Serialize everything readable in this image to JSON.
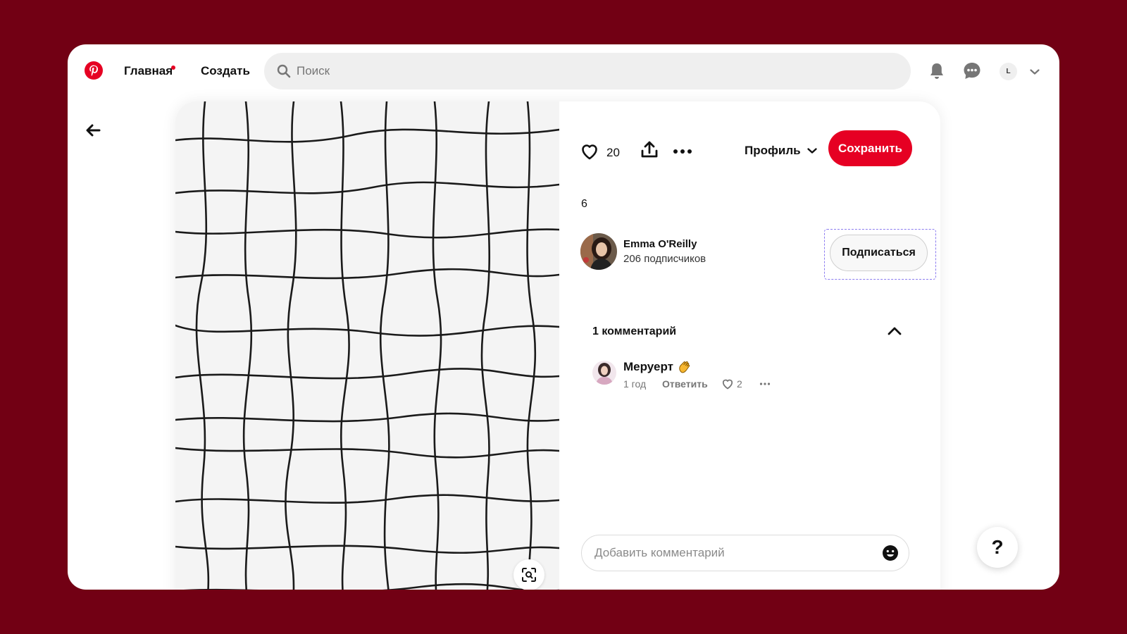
{
  "colors": {
    "brand": "#e60023",
    "background": "#720014",
    "focus_outline": "#8c7cf0"
  },
  "header": {
    "logo_icon": "pinterest-logo-icon",
    "nav": {
      "home": "Главная",
      "create": "Создать"
    },
    "search": {
      "placeholder": "Поиск",
      "value": ""
    },
    "icons": [
      "bell-icon",
      "chat-icon",
      "chevron-down-icon"
    ],
    "account_initial": "L"
  },
  "pin": {
    "image_icon": "lens-search-icon",
    "like_count": "20",
    "board_select": "Профиль",
    "save_label": "Сохранить",
    "description": "6",
    "author": {
      "name": "Emma O'Reilly",
      "followers": "206 подписчиков",
      "follow_label": "Подписаться"
    },
    "comments": {
      "title": "1 комментарий",
      "items": [
        {
          "author": "Меруерт",
          "emoji": "clapping-hands-emoji",
          "time": "1 год",
          "reply_label": "Ответить",
          "likes": "2"
        }
      ]
    },
    "comment_input_placeholder": "Добавить комментарий"
  },
  "help_label": "?"
}
